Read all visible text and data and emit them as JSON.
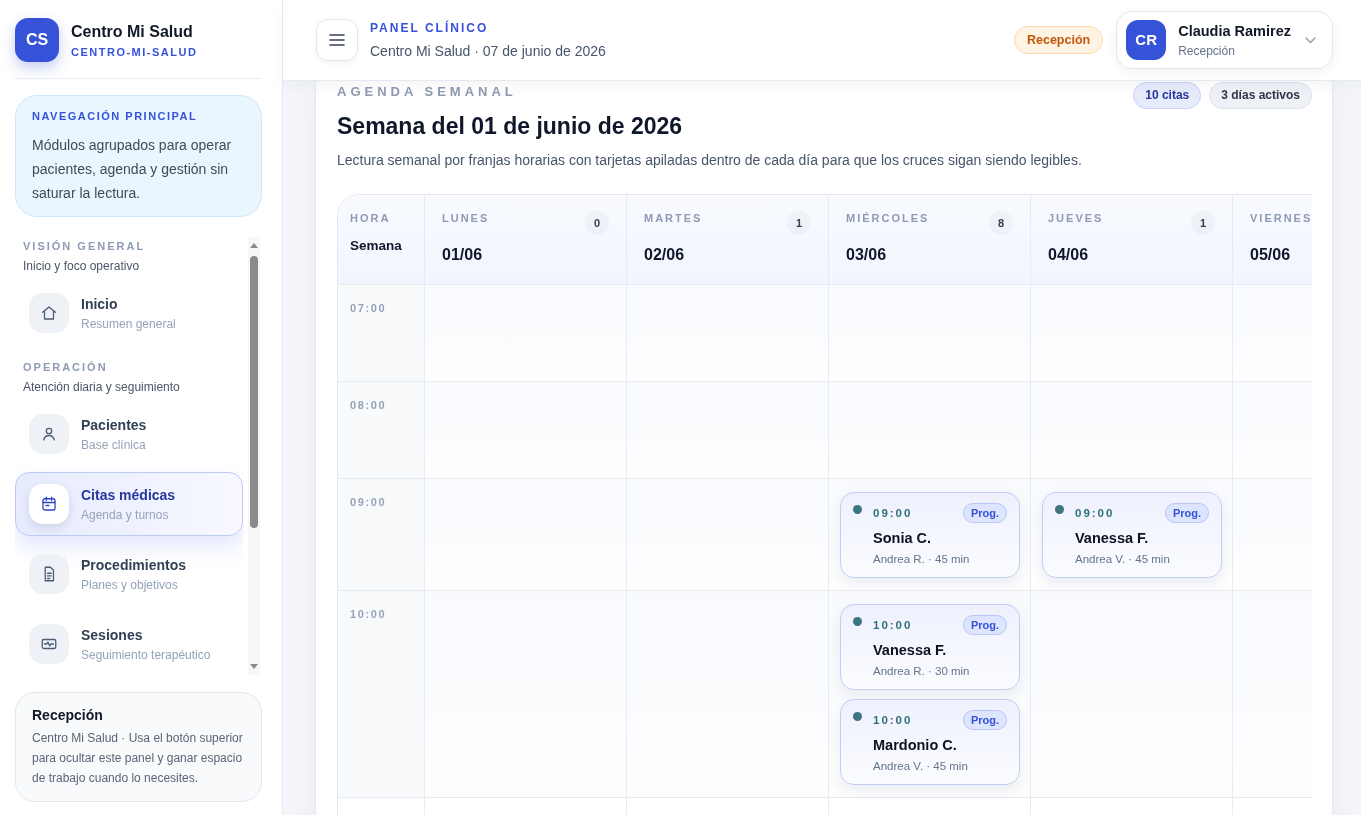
{
  "sidebar": {
    "brand": {
      "initials": "CS",
      "name": "Centro Mi Salud",
      "slug": "CENTRO-MI-SALUD"
    },
    "intro": {
      "title": "NAVEGACIÓN PRINCIPAL",
      "text": "Módulos agrupados para operar pacientes, agenda y gestión sin saturar la lectura."
    },
    "groups": [
      {
        "title": "VISIÓN GENERAL",
        "subtitle": "Inicio y foco operativo",
        "items": [
          {
            "label": "Inicio",
            "subtitle": "Resumen general",
            "selected": false
          }
        ]
      },
      {
        "title": "OPERACIÓN",
        "subtitle": "Atención diaria y seguimiento",
        "items": [
          {
            "label": "Pacientes",
            "subtitle": "Base clínica",
            "selected": false
          },
          {
            "label": "Citas médicas",
            "subtitle": "Agenda y turnos",
            "selected": true
          },
          {
            "label": "Procedimientos",
            "subtitle": "Planes y objetivos",
            "selected": false
          },
          {
            "label": "Sesiones",
            "subtitle": "Seguimiento terapéutico",
            "selected": false
          }
        ]
      }
    ],
    "footer": {
      "title": "Recepción",
      "text": "Centro Mi Salud · Usa el botón superior para ocultar este panel y ganar espacio de trabajo cuando lo necesites."
    }
  },
  "header": {
    "eyebrow": "PANEL CLÍNICO",
    "subtitle": "Centro Mi Salud · 07 de junio de 2026",
    "role_badge": "Recepción",
    "user": {
      "initials": "CR",
      "name": "Claudia Ramirez",
      "role": "Recepción"
    }
  },
  "agenda": {
    "eyebrow": "AGENDA SEMANAL",
    "badges": [
      {
        "text": "10 citas",
        "kind": "primary"
      },
      {
        "text": "3 días activos",
        "kind": "neutral"
      }
    ],
    "title": "Semana del 01 de junio de 2026",
    "description": "Lectura semanal por franjas horarias con tarjetas apiladas dentro de cada día para que los cruces sigan siendo legibles.",
    "time_header": {
      "label": "HORA",
      "caption": "Semana"
    },
    "days": [
      {
        "name": "LUNES",
        "date": "01/06",
        "count": "0"
      },
      {
        "name": "MARTES",
        "date": "02/06",
        "count": "1"
      },
      {
        "name": "MIÉRCOLES",
        "date": "03/06",
        "count": "8"
      },
      {
        "name": "JUEVES",
        "date": "04/06",
        "count": "1"
      },
      {
        "name": "VIERNES",
        "date": "05/06"
      }
    ],
    "rows": [
      {
        "time": "07:00"
      },
      {
        "time": "08:00"
      },
      {
        "time": "09:00",
        "cells": [
          {},
          {},
          {
            "appointments": [
              {
                "time": "09:00",
                "status": "Prog.",
                "patient": "Sonia C.",
                "detail": "Andrea R. · 45 min"
              }
            ]
          },
          {
            "appointments": [
              {
                "time": "09:00",
                "status": "Prog.",
                "patient": "Vanessa F.",
                "detail": "Andrea V. · 45 min"
              }
            ]
          },
          {}
        ]
      },
      {
        "time": "10:00",
        "cells": [
          {},
          {},
          {
            "appointments": [
              {
                "time": "10:00",
                "status": "Prog.",
                "patient": "Vanessa F.",
                "detail": "Andrea R. · 30 min"
              },
              {
                "time": "10:00",
                "status": "Prog.",
                "patient": "Mardonio C.",
                "detail": "Andrea V. · 45 min"
              }
            ]
          },
          {},
          {}
        ]
      }
    ]
  }
}
